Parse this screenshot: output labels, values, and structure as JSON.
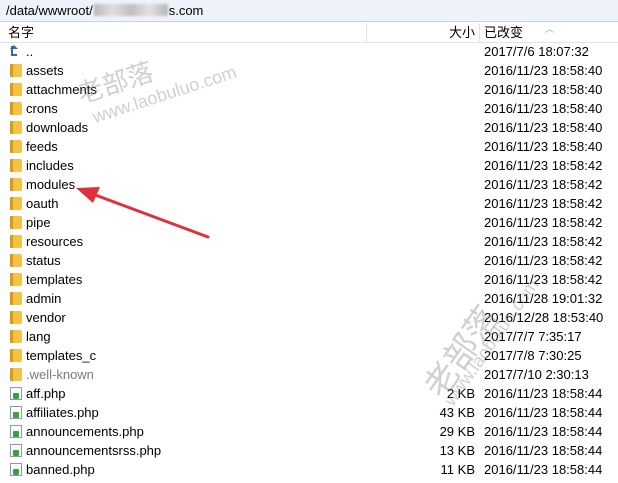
{
  "path": {
    "prefix": "/data/wwwroot/",
    "suffix": "s.com"
  },
  "header": {
    "name": "名字",
    "size": "大小",
    "modified": "已改变"
  },
  "rows": [
    {
      "name": "..",
      "size": "",
      "date": "2017/7/6 18:07:32",
      "icon": "up-folder-icon"
    },
    {
      "name": "assets",
      "size": "",
      "date": "2016/11/23 18:58:40",
      "icon": "folder-icon"
    },
    {
      "name": "attachments",
      "size": "",
      "date": "2016/11/23 18:58:40",
      "icon": "folder-icon"
    },
    {
      "name": "crons",
      "size": "",
      "date": "2016/11/23 18:58:40",
      "icon": "folder-icon"
    },
    {
      "name": "downloads",
      "size": "",
      "date": "2016/11/23 18:58:40",
      "icon": "folder-icon"
    },
    {
      "name": "feeds",
      "size": "",
      "date": "2016/11/23 18:58:40",
      "icon": "folder-icon"
    },
    {
      "name": "includes",
      "size": "",
      "date": "2016/11/23 18:58:42",
      "icon": "folder-icon"
    },
    {
      "name": "modules",
      "size": "",
      "date": "2016/11/23 18:58:42",
      "icon": "folder-icon"
    },
    {
      "name": "oauth",
      "size": "",
      "date": "2016/11/23 18:58:42",
      "icon": "folder-icon"
    },
    {
      "name": "pipe",
      "size": "",
      "date": "2016/11/23 18:58:42",
      "icon": "folder-icon"
    },
    {
      "name": "resources",
      "size": "",
      "date": "2016/11/23 18:58:42",
      "icon": "folder-icon"
    },
    {
      "name": "status",
      "size": "",
      "date": "2016/11/23 18:58:42",
      "icon": "folder-icon"
    },
    {
      "name": "templates",
      "size": "",
      "date": "2016/11/23 18:58:42",
      "icon": "folder-icon"
    },
    {
      "name": "admin",
      "size": "",
      "date": "2016/11/28 19:01:32",
      "icon": "folder-icon"
    },
    {
      "name": "vendor",
      "size": "",
      "date": "2016/12/28 18:53:40",
      "icon": "folder-icon"
    },
    {
      "name": "lang",
      "size": "",
      "date": "2017/7/7 7:35:17",
      "icon": "folder-icon"
    },
    {
      "name": "templates_c",
      "size": "",
      "date": "2017/7/8 7:30:25",
      "icon": "folder-icon"
    },
    {
      "name": ".well-known",
      "size": "",
      "date": "2017/7/10 2:30:13",
      "icon": "folder-icon",
      "dim": true
    },
    {
      "name": "aff.php",
      "size": "2 KB",
      "date": "2016/11/23 18:58:44",
      "icon": "php-file-icon"
    },
    {
      "name": "affiliates.php",
      "size": "43 KB",
      "date": "2016/11/23 18:58:44",
      "icon": "php-file-icon"
    },
    {
      "name": "announcements.php",
      "size": "29 KB",
      "date": "2016/11/23 18:58:44",
      "icon": "php-file-icon"
    },
    {
      "name": "announcementsrss.php",
      "size": "13 KB",
      "date": "2016/11/23 18:58:44",
      "icon": "php-file-icon"
    },
    {
      "name": "banned.php",
      "size": "11 KB",
      "date": "2016/11/23 18:58:44",
      "icon": "php-file-icon"
    }
  ],
  "watermark": {
    "text_cn": "老部落",
    "url": "www.laobuluo.com"
  },
  "colors": {
    "path_bar_bg": "#eef3fa",
    "folder": "#f5c343",
    "arrow": "#e0303a"
  }
}
